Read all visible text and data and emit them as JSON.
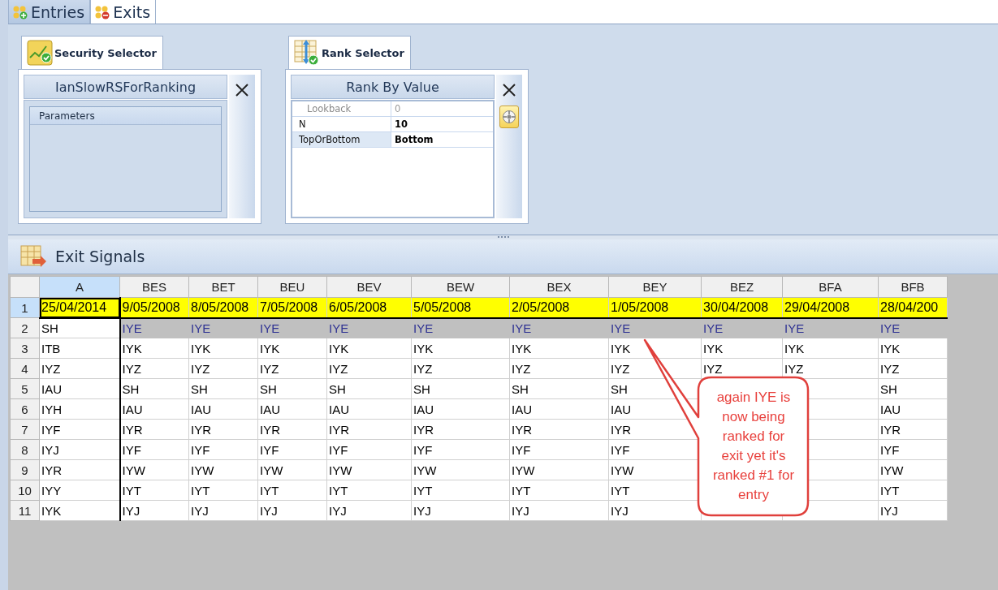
{
  "tabs": [
    {
      "label": "Entries",
      "selected": false
    },
    {
      "label": "Exits",
      "selected": true
    }
  ],
  "selectors": [
    {
      "kind": "security",
      "tab_label": "Security Selector",
      "title": "IanSlowRSForRanking",
      "group_label": "Parameters"
    },
    {
      "kind": "rank",
      "tab_label": "Rank Selector",
      "title": "Rank By Value",
      "properties": [
        {
          "name": "Lookback",
          "value": "0",
          "disabled": true,
          "selected": false
        },
        {
          "name": "N",
          "value": "10",
          "disabled": false,
          "selected": false
        },
        {
          "name": "TopOrBottom",
          "value": "Bottom",
          "disabled": false,
          "selected": true
        }
      ]
    }
  ],
  "exit_signals": {
    "title": "Exit Signals",
    "columns": [
      {
        "label": "A",
        "selected": true
      },
      {
        "label": "BES",
        "selected": false
      },
      {
        "label": "BET",
        "selected": false
      },
      {
        "label": "BEU",
        "selected": false
      },
      {
        "label": "BEV",
        "selected": false
      },
      {
        "label": "BEW",
        "selected": false
      },
      {
        "label": "BEX",
        "selected": false
      },
      {
        "label": "BEY",
        "selected": false
      },
      {
        "label": "BEZ",
        "selected": false
      },
      {
        "label": "BFA",
        "selected": false
      },
      {
        "label": "BFB",
        "selected": false
      }
    ],
    "rows": [
      {
        "label": "1",
        "kind": "date",
        "selected": true,
        "cells": [
          "25/04/2014",
          "9/05/2008",
          "8/05/2008",
          "7/05/2008",
          "6/05/2008",
          "5/05/2008",
          "2/05/2008",
          "1/05/2008",
          "30/04/2008",
          "29/04/2008",
          "28/04/200"
        ]
      },
      {
        "label": "2",
        "kind": "highlight",
        "selected": false,
        "cells": [
          "SH",
          "IYE",
          "IYE",
          "IYE",
          "IYE",
          "IYE",
          "IYE",
          "IYE",
          "IYE",
          "IYE",
          "IYE"
        ]
      },
      {
        "label": "3",
        "kind": "plain",
        "selected": false,
        "cells": [
          "ITB",
          "IYK",
          "IYK",
          "IYK",
          "IYK",
          "IYK",
          "IYK",
          "IYK",
          "IYK",
          "IYK",
          "IYK"
        ]
      },
      {
        "label": "4",
        "kind": "plain",
        "selected": false,
        "cells": [
          "IYZ",
          "IYZ",
          "IYZ",
          "IYZ",
          "IYZ",
          "IYZ",
          "IYZ",
          "IYZ",
          "IYZ",
          "IYZ",
          "IYZ"
        ]
      },
      {
        "label": "5",
        "kind": "plain",
        "selected": false,
        "cells": [
          "IAU",
          "SH",
          "SH",
          "SH",
          "SH",
          "SH",
          "SH",
          "SH",
          null,
          null,
          "SH"
        ]
      },
      {
        "label": "6",
        "kind": "plain",
        "selected": false,
        "cells": [
          "IYH",
          "IAU",
          "IAU",
          "IAU",
          "IAU",
          "IAU",
          "IAU",
          "IAU",
          null,
          null,
          "IAU"
        ]
      },
      {
        "label": "7",
        "kind": "plain",
        "selected": false,
        "cells": [
          "IYF",
          "IYR",
          "IYR",
          "IYR",
          "IYR",
          "IYR",
          "IYR",
          "IYR",
          null,
          null,
          "IYR"
        ]
      },
      {
        "label": "8",
        "kind": "plain",
        "selected": false,
        "cells": [
          "IYJ",
          "IYF",
          "IYF",
          "IYF",
          "IYF",
          "IYF",
          "IYF",
          "IYF",
          null,
          null,
          "IYF"
        ]
      },
      {
        "label": "9",
        "kind": "plain",
        "selected": false,
        "cells": [
          "IYR",
          "IYW",
          "IYW",
          "IYW",
          "IYW",
          "IYW",
          "IYW",
          "IYW",
          null,
          null,
          "IYW"
        ]
      },
      {
        "label": "10",
        "kind": "plain",
        "selected": false,
        "cells": [
          "IYY",
          "IYT",
          "IYT",
          "IYT",
          "IYT",
          "IYT",
          "IYT",
          "IYT",
          null,
          null,
          "IYT"
        ]
      },
      {
        "label": "11",
        "kind": "plain",
        "selected": false,
        "cells": [
          "IYK",
          "IYJ",
          "IYJ",
          "IYJ",
          "IYJ",
          "IYJ",
          "IYJ",
          "IYJ",
          null,
          null,
          "IYJ"
        ]
      }
    ]
  },
  "callout": {
    "text": "again IYE is now being ranked for exit yet it's ranked #1 for entry"
  }
}
